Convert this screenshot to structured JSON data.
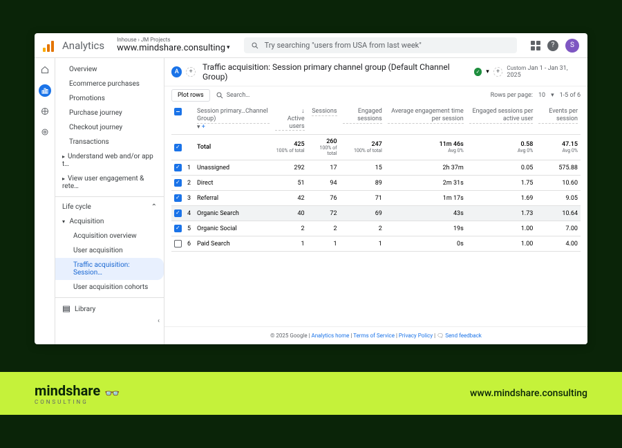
{
  "top": {
    "product": "Analytics",
    "breadcrumb": "Inhouse › JM Projects",
    "site": "www.mindshare.consulting",
    "searchPlaceholder": "Try searching \"users from USA from last week\"",
    "avatarInitial": "S"
  },
  "sidebar": {
    "items1": [
      "Overview",
      "Ecommerce purchases",
      "Promotions",
      "Purchase journey",
      "Checkout journey",
      "Transactions"
    ],
    "arrowItems": [
      "Understand web and/or app t…",
      "View user engagement & rete…"
    ],
    "sectionTitle": "Life cycle",
    "acquisition": "Acquisition",
    "acqChildren": [
      "Acquisition overview",
      "User acquisition",
      "Traffic acquisition: Session…",
      "User acquisition cohorts"
    ],
    "activeIndex": 2,
    "library": "Library"
  },
  "report": {
    "badge": "A",
    "title": "Traffic acquisition: Session primary channel group (Default Channel Group)",
    "dateLabel": "Custom",
    "dateRange": "Jan 1 - Jan 31, 2025",
    "plotBtn": "Plot rows",
    "searchPlaceholder": "Search…",
    "rowsLabel": "Rows per page:",
    "rowsValue": "10",
    "pageInfo": "1-5 of 6",
    "dimHeader": "Session primary…Channel Group)",
    "columns": [
      "Active users",
      "Sessions",
      "Engaged sessions",
      "Average engagement time per session",
      "Engaged sessions per active user",
      "Events per session"
    ],
    "totalLabel": "Total",
    "total": {
      "users": "425",
      "usersSub": "100% of total",
      "sessions": "260",
      "sessionsSub": "100% of total",
      "engaged": "247",
      "engagedSub": "100% of total",
      "avgTime": "11m 46s",
      "avgTimeSub": "Avg 0%",
      "espau": "0.58",
      "espauSub": "Avg 0%",
      "eps": "47.15",
      "epsSub": "Avg 0%"
    },
    "rows": [
      {
        "n": "1",
        "name": "Unassigned",
        "checked": true,
        "users": "292",
        "sessions": "17",
        "engaged": "15",
        "avgTime": "2h 37m",
        "espau": "0.05",
        "eps": "575.88"
      },
      {
        "n": "2",
        "name": "Direct",
        "checked": true,
        "users": "51",
        "sessions": "94",
        "engaged": "89",
        "avgTime": "2m 31s",
        "espau": "1.75",
        "eps": "10.60"
      },
      {
        "n": "3",
        "name": "Referral",
        "checked": true,
        "users": "42",
        "sessions": "76",
        "engaged": "71",
        "avgTime": "1m 17s",
        "espau": "1.69",
        "eps": "9.05"
      },
      {
        "n": "4",
        "name": "Organic Search",
        "checked": true,
        "hl": true,
        "users": "40",
        "sessions": "72",
        "engaged": "69",
        "avgTime": "43s",
        "espau": "1.73",
        "eps": "10.64"
      },
      {
        "n": "5",
        "name": "Organic Social",
        "checked": true,
        "users": "2",
        "sessions": "2",
        "engaged": "2",
        "avgTime": "19s",
        "espau": "1.00",
        "eps": "7.00"
      },
      {
        "n": "6",
        "name": "Paid Search",
        "checked": false,
        "users": "1",
        "sessions": "1",
        "engaged": "1",
        "avgTime": "0s",
        "espau": "1.00",
        "eps": "4.00"
      }
    ]
  },
  "footer": {
    "copyright": "© 2025 Google",
    "links": [
      "Analytics home",
      "Terms of Service",
      "Privacy Policy"
    ],
    "feedback": "Send feedback"
  },
  "brand": {
    "name": "mindshare",
    "sub": "CONSULTING",
    "url": "www.mindshare.consulting"
  }
}
